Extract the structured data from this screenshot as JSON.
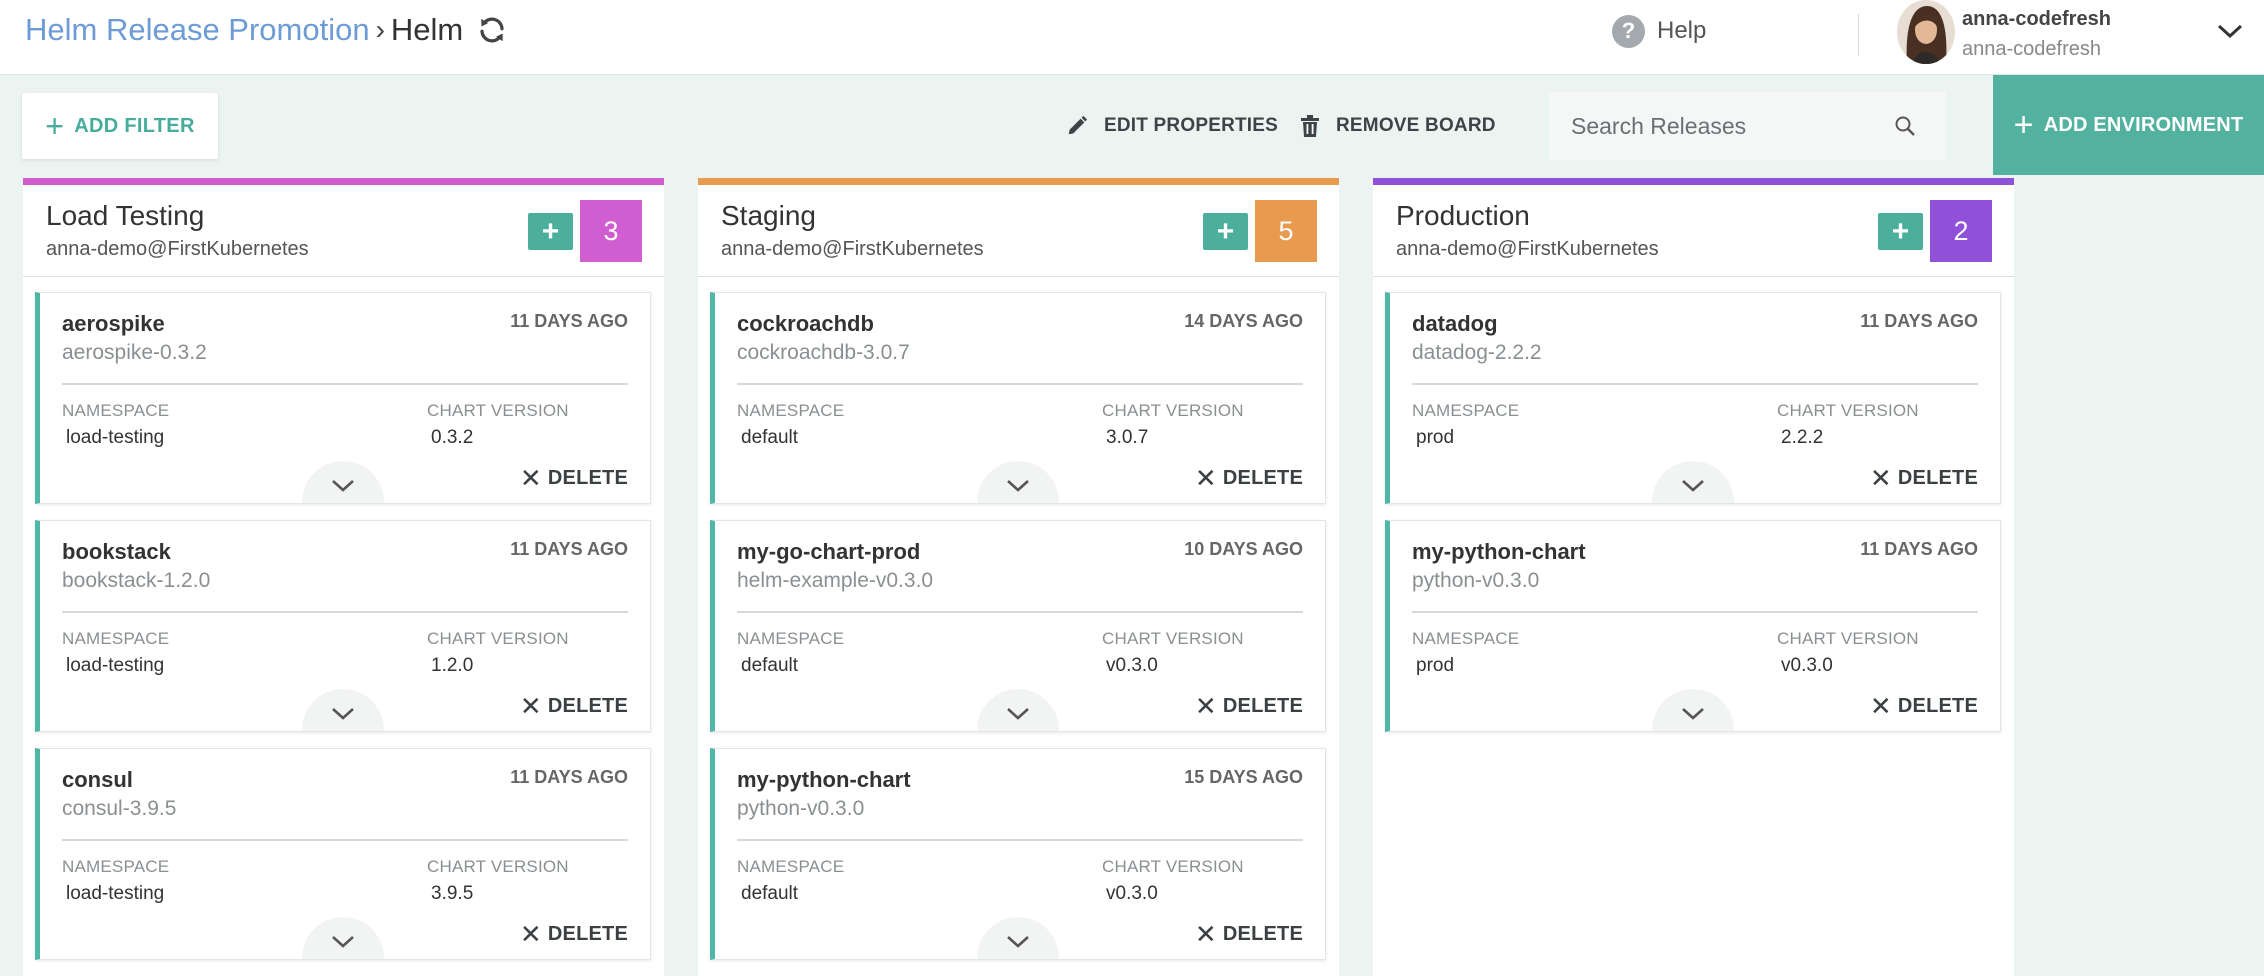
{
  "header": {
    "breadcrumb_parent": "Helm Release Promotion",
    "breadcrumb_separator": "›",
    "breadcrumb_current": "Helm",
    "help_label": "Help",
    "user_name": "anna-codefresh",
    "user_account": "anna-codefresh"
  },
  "toolbar": {
    "add_filter_label": "ADD FILTER",
    "edit_properties_label": "EDIT PROPERTIES",
    "remove_board_label": "REMOVE BOARD",
    "search_placeholder": "Search Releases",
    "add_environment_label": "ADD ENVIRONMENT"
  },
  "card_labels": {
    "namespace": "NAMESPACE",
    "chart_version": "CHART VERSION",
    "delete": "DELETE"
  },
  "colors": {
    "accent": "#53b19f",
    "load_testing": "#d05ed0",
    "staging": "#e89a4f",
    "production": "#9150d8"
  },
  "columns": [
    {
      "title": "Load Testing",
      "cluster": "anna-demo@FirstKubernetes",
      "count": "3",
      "color": "#d05ed0",
      "releases": [
        {
          "name": "aerospike",
          "chart": "aerospike-0.3.2",
          "age": "11 DAYS AGO",
          "namespace": "load-testing",
          "chart_version": "0.3.2"
        },
        {
          "name": "bookstack",
          "chart": "bookstack-1.2.0",
          "age": "11 DAYS AGO",
          "namespace": "load-testing",
          "chart_version": "1.2.0"
        },
        {
          "name": "consul",
          "chart": "consul-3.9.5",
          "age": "11 DAYS AGO",
          "namespace": "load-testing",
          "chart_version": "3.9.5"
        }
      ]
    },
    {
      "title": "Staging",
      "cluster": "anna-demo@FirstKubernetes",
      "count": "5",
      "color": "#e89a4f",
      "releases": [
        {
          "name": "cockroachdb",
          "chart": "cockroachdb-3.0.7",
          "age": "14 DAYS AGO",
          "namespace": "default",
          "chart_version": "3.0.7"
        },
        {
          "name": "my-go-chart-prod",
          "chart": "helm-example-v0.3.0",
          "age": "10 DAYS AGO",
          "namespace": "default",
          "chart_version": "v0.3.0"
        },
        {
          "name": "my-python-chart",
          "chart": "python-v0.3.0",
          "age": "15 DAYS AGO",
          "namespace": "default",
          "chart_version": "v0.3.0"
        }
      ]
    },
    {
      "title": "Production",
      "cluster": "anna-demo@FirstKubernetes",
      "count": "2",
      "color": "#9150d8",
      "releases": [
        {
          "name": "datadog",
          "chart": "datadog-2.2.2",
          "age": "11 DAYS AGO",
          "namespace": "prod",
          "chart_version": "2.2.2"
        },
        {
          "name": "my-python-chart",
          "chart": "python-v0.3.0",
          "age": "11 DAYS AGO",
          "namespace": "prod",
          "chart_version": "v0.3.0"
        }
      ]
    }
  ]
}
